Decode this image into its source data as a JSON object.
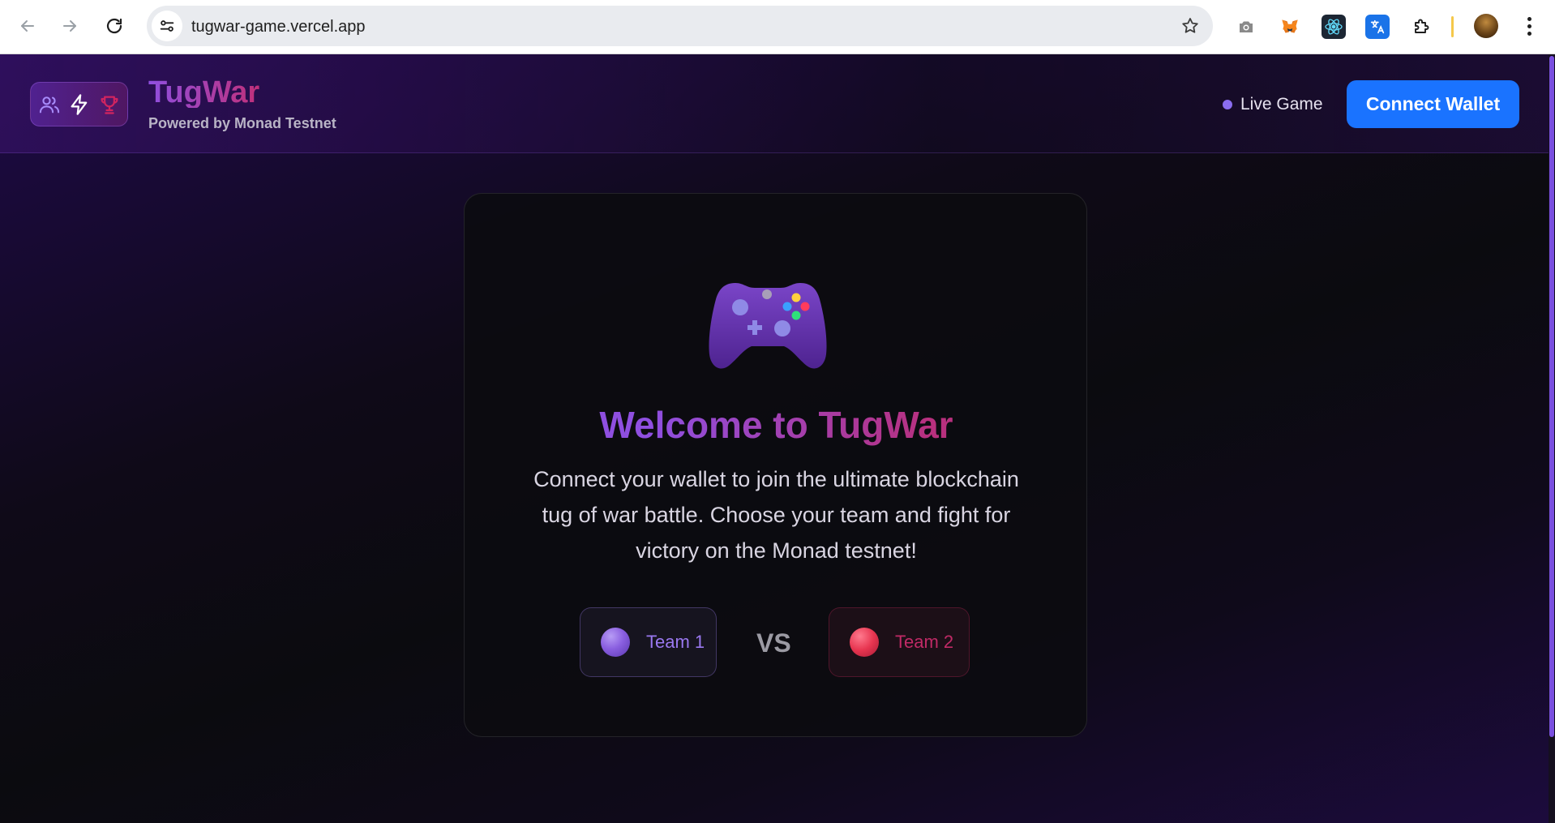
{
  "browser": {
    "url": "tugwar-game.vercel.app",
    "back_icon": "arrow-left-icon",
    "forward_icon": "arrow-right-icon",
    "reload_icon": "reload-icon",
    "extensions": [
      "camera-icon",
      "metamask-fox-icon",
      "react-devtools-icon",
      "translate-icon",
      "puzzle-extensions-icon"
    ]
  },
  "header": {
    "logo_icons": [
      "users-icon",
      "lightning-icon",
      "trophy-icon"
    ],
    "title": "TugWar",
    "subtitle": "Powered by Monad Testnet",
    "live_label": "Live Game",
    "connect_label": "Connect Wallet"
  },
  "card": {
    "icon": "game-controller-icon",
    "heading": "Welcome to TugWar",
    "description": "Connect your wallet to join the ultimate blockchain tug of war battle. Choose your team and fight for victory on the Monad testnet!",
    "team1": "Team 1",
    "vs": "VS",
    "team2": "Team 2"
  },
  "colors": {
    "accent_purple": "#8f4fe0",
    "accent_pink": "#c0307a",
    "button_blue": "#1a73ff",
    "team1": "#9a78f0",
    "team2": "#e73550"
  }
}
